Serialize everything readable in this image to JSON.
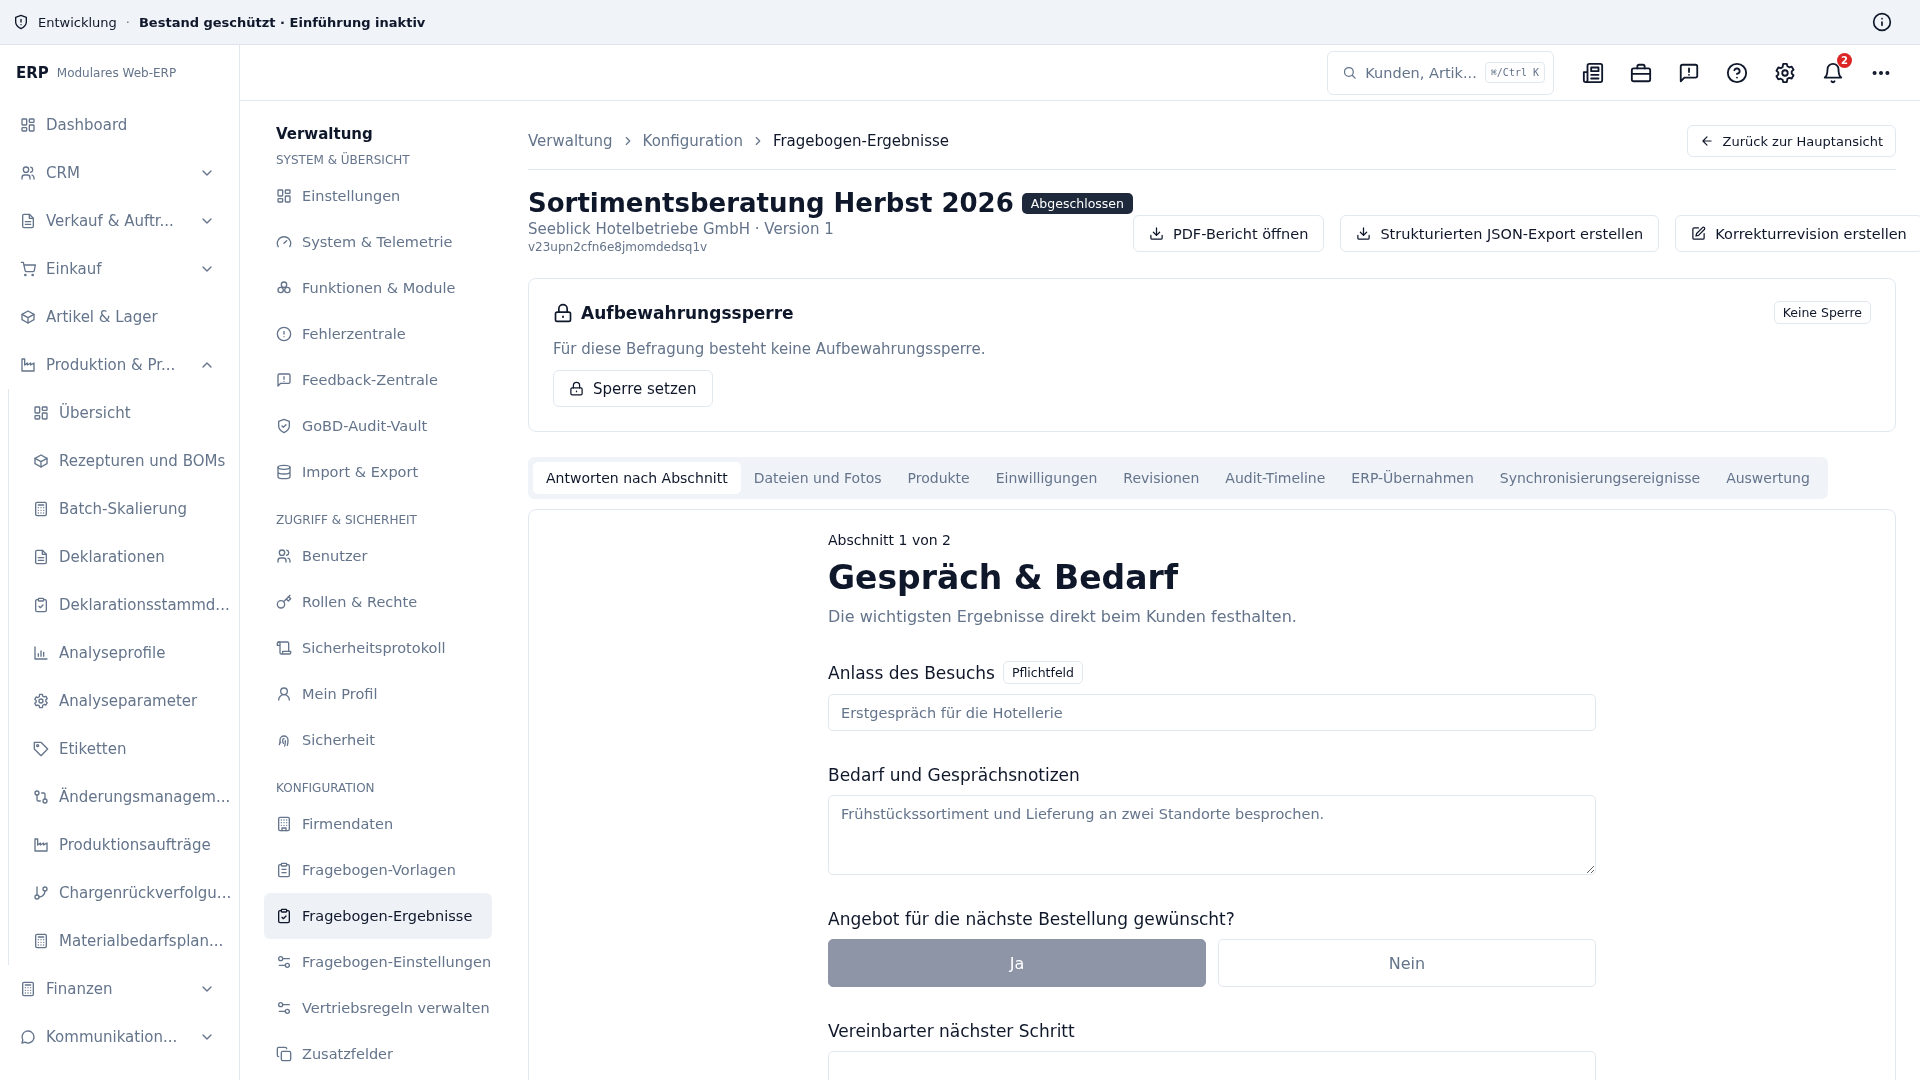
{
  "env_bar": {
    "environment": "Entwicklung",
    "separator": "·",
    "status": "Bestand geschützt · Einführung inaktiv"
  },
  "brand": {
    "name": "ERP",
    "subtitle": "Modulares Web-ERP"
  },
  "nav": [
    {
      "kind": "link",
      "label": "Dashboard"
    },
    {
      "kind": "group",
      "label": "CRM",
      "expanded": false
    },
    {
      "kind": "group",
      "label": "Verkauf & Auftr...",
      "expanded": false
    },
    {
      "kind": "group",
      "label": "Einkauf",
      "expanded": false
    },
    {
      "kind": "link",
      "label": "Artikel & Lager"
    },
    {
      "kind": "group",
      "label": "Produktion & Pr...",
      "expanded": true,
      "children": [
        {
          "label": "Übersicht"
        },
        {
          "label": "Rezepturen und BOMs"
        },
        {
          "label": "Batch-Skalierung"
        },
        {
          "label": "Deklarationen"
        },
        {
          "label": "Deklarationsstammd..."
        },
        {
          "label": "Analyseprofile"
        },
        {
          "label": "Analyseparameter"
        },
        {
          "label": "Etiketten"
        },
        {
          "label": "Änderungsmanagem..."
        },
        {
          "label": "Produktionsaufträge"
        },
        {
          "label": "Chargenrückverfolgu..."
        },
        {
          "label": "Materialbedarfsplan..."
        }
      ]
    },
    {
      "kind": "group",
      "label": "Finanzen",
      "expanded": false
    },
    {
      "kind": "group",
      "label": "Kommunikation...",
      "expanded": false
    }
  ],
  "search": {
    "placeholder": "Kunden, Artik...",
    "shortcut": "⌘/Ctrl K"
  },
  "notifications": {
    "count": "2"
  },
  "admin_nav": {
    "title": "Verwaltung",
    "sections": [
      {
        "heading": "SYSTEM & ÜBERSICHT",
        "items": [
          {
            "label": "Einstellungen",
            "selected": false
          },
          {
            "label": "System & Telemetrie",
            "selected": false
          },
          {
            "label": "Funktionen & Module",
            "selected": false
          },
          {
            "label": "Fehlerzentrale",
            "selected": false
          },
          {
            "label": "Feedback-Zentrale",
            "selected": false
          },
          {
            "label": "GoBD-Audit-Vault",
            "selected": false
          },
          {
            "label": "Import & Export",
            "selected": false
          }
        ]
      },
      {
        "heading": "ZUGRIFF & SICHERHEIT",
        "items": [
          {
            "label": "Benutzer",
            "selected": false
          },
          {
            "label": "Rollen & Rechte",
            "selected": false
          },
          {
            "label": "Sicherheitsprotokoll",
            "selected": false
          },
          {
            "label": "Mein Profil",
            "selected": false
          },
          {
            "label": "Sicherheit",
            "selected": false
          }
        ]
      },
      {
        "heading": "KONFIGURATION",
        "items": [
          {
            "label": "Firmendaten",
            "selected": false
          },
          {
            "label": "Fragebogen-Vorlagen",
            "selected": false
          },
          {
            "label": "Fragebogen-Ergebnisse",
            "selected": true
          },
          {
            "label": "Fragebogen-Einstellungen",
            "selected": false
          },
          {
            "label": "Vertriebsregeln verwalten",
            "selected": false
          },
          {
            "label": "Zusatzfelder",
            "selected": false
          }
        ]
      }
    ]
  },
  "breadcrumb": [
    "Verwaltung",
    "Konfiguration",
    "Fragebogen-Ergebnisse"
  ],
  "back_button": "Zurück zur Hauptansicht",
  "survey": {
    "title": "Sortimentsberatung Herbst 2026",
    "status": "Abgeschlossen",
    "customer": "Seeblick Hotelbetriebe GmbH · Version 1",
    "id": "v23upn2cfn6e8jmomdedsq1v"
  },
  "actions": [
    "PDF-Bericht öffnen",
    "Strukturierten JSON-Export erstellen",
    "Korrekturrevision erstellen"
  ],
  "retention_lock": {
    "title": "Aufbewahrungssperre",
    "badge": "Keine Sperre",
    "message": "Für diese Befragung besteht keine Aufbewahrungssperre.",
    "button": "Sperre setzen"
  },
  "tabs": [
    {
      "label": "Antworten nach Abschnitt",
      "selected": true
    },
    {
      "label": "Dateien und Fotos",
      "selected": false
    },
    {
      "label": "Produkte",
      "selected": false
    },
    {
      "label": "Einwilligungen",
      "selected": false
    },
    {
      "label": "Revisionen",
      "selected": false
    },
    {
      "label": "Audit-Timeline",
      "selected": false
    },
    {
      "label": "ERP-Übernahmen",
      "selected": false
    },
    {
      "label": "Synchronisierungsereignisse",
      "selected": false
    },
    {
      "label": "Auswertung",
      "selected": false
    }
  ],
  "section": {
    "counter": "Abschnitt 1 von 2",
    "title": "Gespräch & Bedarf",
    "description": "Die wichtigsten Ergebnisse direkt beim Kunden festhalten.",
    "fields": [
      {
        "kind": "text",
        "label": "Anlass des Besuchs",
        "badge": "Pflichtfeld",
        "value": "Erstgespräch für die Hotellerie"
      },
      {
        "kind": "textarea",
        "label": "Bedarf und Gesprächsnotizen",
        "value": "Frühstückssortiment und Lieferung an zwei Standorte besprochen."
      },
      {
        "kind": "choice",
        "label": "Angebot für die nächste Bestellung gewünscht?",
        "options": [
          {
            "label": "Ja",
            "selected": true
          },
          {
            "label": "Nein",
            "selected": false
          }
        ]
      },
      {
        "kind": "text",
        "label": "Vereinbarter nächster Schritt"
      }
    ]
  }
}
